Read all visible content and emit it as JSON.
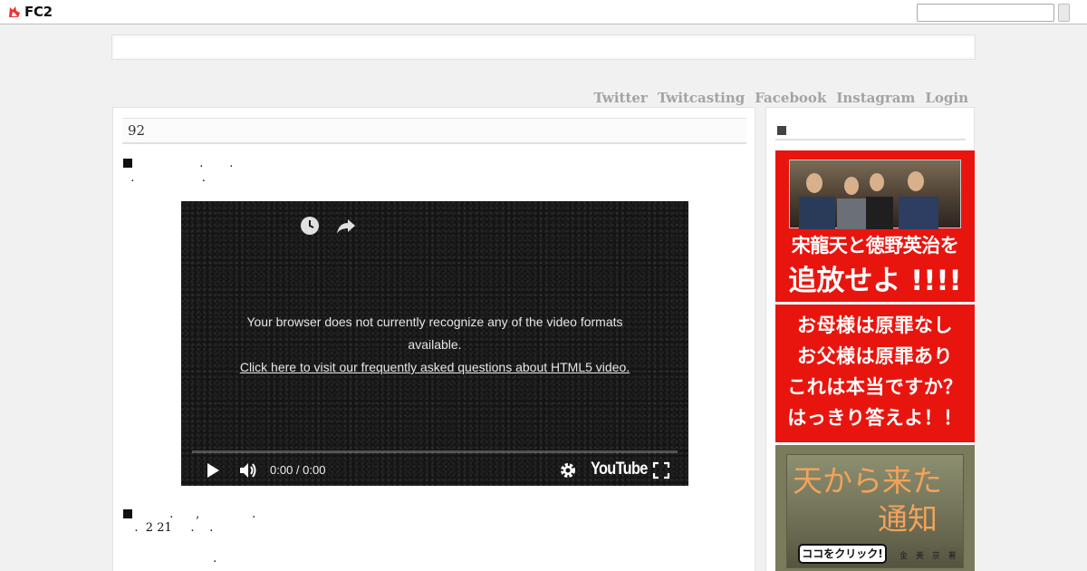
{
  "topbar": {
    "logo_text": "FC2",
    "search_value": ""
  },
  "nav": {
    "links": [
      "Twitter",
      "Twitcasting",
      "Facebook",
      "Instagram",
      "Login"
    ]
  },
  "post": {
    "title": "92",
    "para1_line1": "                 .       .",
    "para1_line2": "  .                  .",
    "para2_line1": "         .      ,              .",
    "para2_line2": "   .  2 21     .    .",
    "para3_line1": "                        ."
  },
  "video": {
    "message": "Your browser does not currently recognize any of the video formats available.",
    "link_text": "Click here to visit our frequently asked questions about HTML5 video.",
    "time": "0:00 / 0:00",
    "brand": "YouTube",
    "icons": [
      "watch-later-icon",
      "share-icon",
      "play-icon",
      "volume-icon",
      "settings-icon",
      "fullscreen-icon"
    ]
  },
  "sidebar": {
    "banner1": {
      "line1": "宋龍天と徳野英治を",
      "line2": "追放せよ !!!!"
    },
    "banner2": {
      "lines": [
        "お母様は原罪なし",
        "お父様は原罪あり",
        "これは本当ですか？",
        "はっきり答えよ！！"
      ]
    },
    "banner3": {
      "title_top": "天から来た",
      "title_bottom": "通知",
      "button": "ココをクリック!",
      "author": "金 美 京 著"
    }
  },
  "colors": {
    "banner_red": "#e8150f",
    "nav_link": "#a3a3a3"
  }
}
